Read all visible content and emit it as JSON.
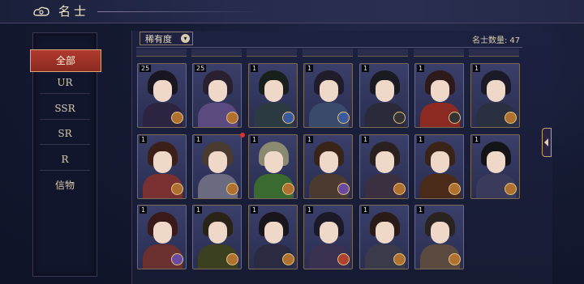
{
  "header": {
    "title": "名士",
    "icon": "cloud-icon"
  },
  "sidebar": {
    "items": [
      {
        "label": "全部",
        "active": true
      },
      {
        "label": "UR"
      },
      {
        "label": "SSR"
      },
      {
        "label": "SR"
      },
      {
        "label": "R"
      },
      {
        "label": "信物"
      }
    ]
  },
  "filter": {
    "label": "稀有度",
    "icon": "chevron-down-icon"
  },
  "count": {
    "label": "名士数量:",
    "value": "47"
  },
  "cards": [
    {
      "level": "25",
      "badge": "gold"
    },
    {
      "level": "25",
      "badge": "gold"
    },
    {
      "level": "1",
      "badge": "blue"
    },
    {
      "level": "1",
      "badge": "blue"
    },
    {
      "level": "1",
      "badge": "dark"
    },
    {
      "level": "1",
      "badge": "dark"
    },
    {
      "level": "1",
      "badge": "gold"
    },
    {
      "level": "1",
      "badge": "gold"
    },
    {
      "level": "1",
      "badge": "gold"
    },
    {
      "level": "1",
      "badge": "gold"
    },
    {
      "level": "1",
      "badge": "purple"
    },
    {
      "level": "1",
      "badge": "gold"
    },
    {
      "level": "1",
      "badge": "gold"
    },
    {
      "level": "1",
      "badge": "gold"
    },
    {
      "level": "1",
      "badge": "purple"
    },
    {
      "level": "1",
      "badge": "gold"
    },
    {
      "level": "1",
      "badge": "gold"
    },
    {
      "level": "1",
      "badge": "red"
    },
    {
      "level": "1",
      "badge": "gold"
    },
    {
      "level": "1",
      "badge": "gold"
    }
  ]
}
